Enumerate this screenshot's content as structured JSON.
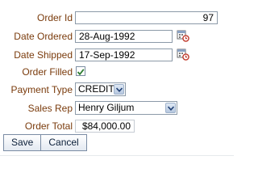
{
  "form": {
    "order_id": {
      "label": "Order Id",
      "value": "97"
    },
    "date_ordered": {
      "label": "Date Ordered",
      "value": "28-Aug-1992",
      "icon": "calendar-icon"
    },
    "date_shipped": {
      "label": "Date Shipped",
      "value": "17-Sep-1992",
      "icon": "calendar-icon"
    },
    "order_filled": {
      "label": "Order Filled",
      "checked": true
    },
    "payment_type": {
      "label": "Payment Type",
      "value": "CREDIT"
    },
    "sales_rep": {
      "label": "Sales Rep",
      "value": "Henry Giljum"
    },
    "order_total": {
      "label": "Order Total",
      "value": "$84,000.00"
    }
  },
  "buttons": {
    "save_label": "Save",
    "cancel_label": "Cancel"
  },
  "colors": {
    "label": "#7a3b0c",
    "border": "#8c9aa8",
    "check": "#2e7d32"
  }
}
